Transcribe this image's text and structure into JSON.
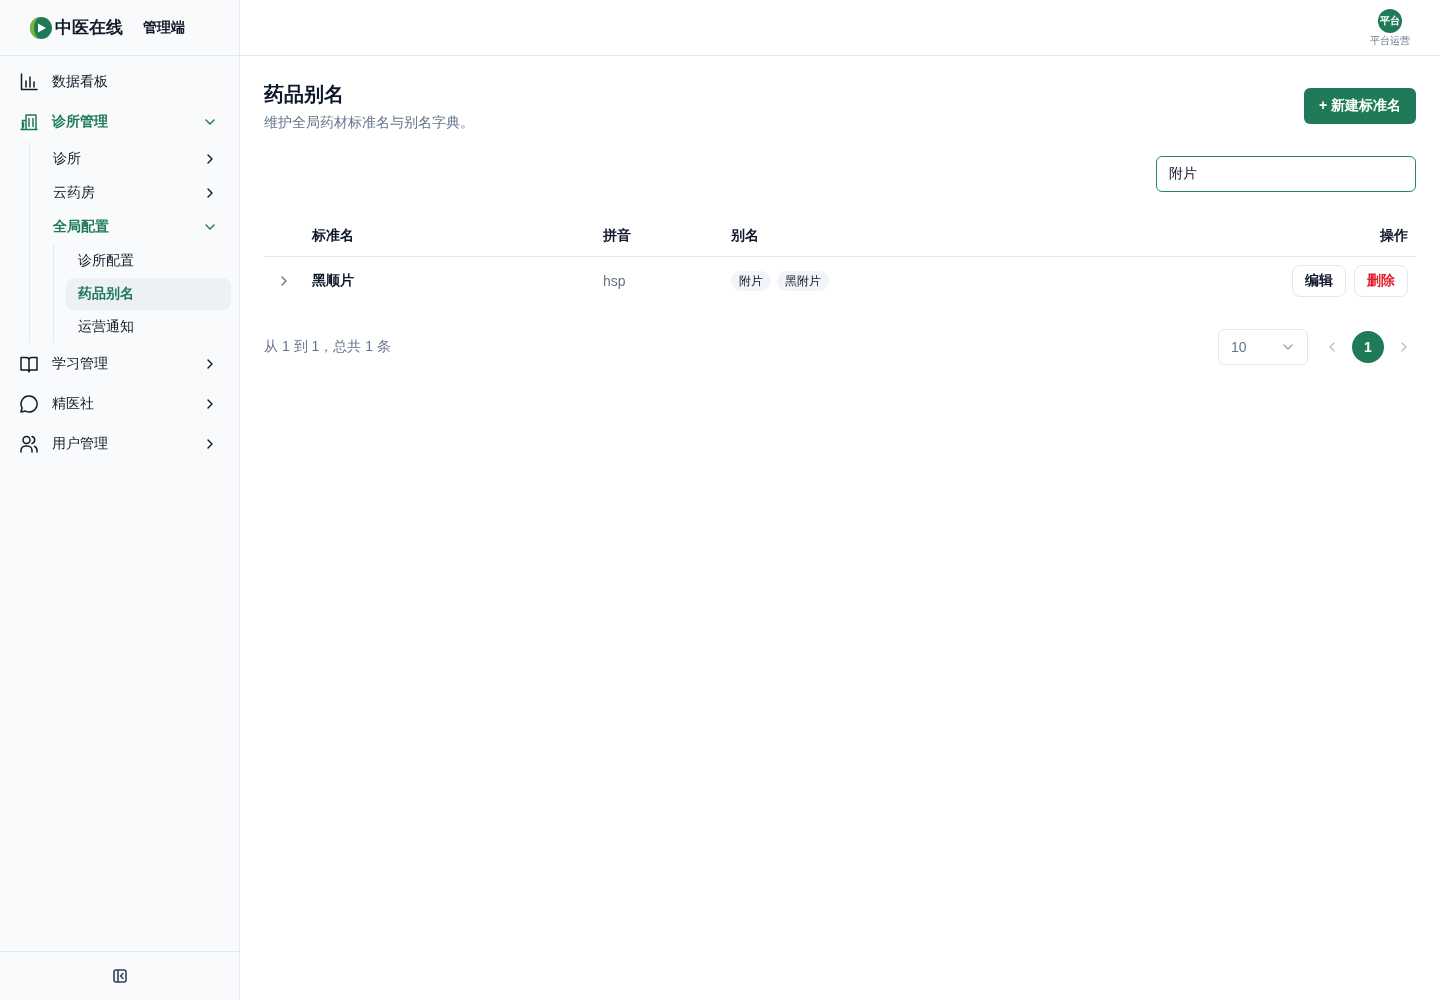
{
  "brand": {
    "name": "中医在线",
    "subtitle": "管理端"
  },
  "sidebar": {
    "items": [
      {
        "label": "数据看板",
        "selected": false
      },
      {
        "label": "诊所管理",
        "expanded": true,
        "children": [
          {
            "label": "诊所",
            "expanded": false
          },
          {
            "label": "云药房",
            "expanded": false
          },
          {
            "label": "全局配置",
            "expanded": true,
            "children": [
              {
                "label": "诊所配置",
                "selected": false
              },
              {
                "label": "药品别名",
                "selected": true
              },
              {
                "label": "运营通知",
                "selected": false
              }
            ]
          }
        ]
      },
      {
        "label": "学习管理",
        "expanded": false
      },
      {
        "label": "精医社",
        "expanded": false
      },
      {
        "label": "用户管理",
        "expanded": false
      }
    ]
  },
  "user": {
    "avatar_text": "平台",
    "role": "平台运营"
  },
  "page": {
    "title": "药品别名",
    "description": "维护全局药材标准名与别名字典。",
    "create_button": "+ 新建标准名"
  },
  "search": {
    "value": "附片",
    "focused": true
  },
  "table": {
    "columns": [
      "标准名",
      "拼音",
      "别名",
      "操作"
    ],
    "rows": [
      {
        "expanded": false,
        "name": "黑顺片",
        "pinyin": "hsp",
        "aliases": [
          "附片",
          "黑附片"
        ],
        "actions": [
          {
            "label": "编辑",
            "kind": "default"
          },
          {
            "label": "删除",
            "kind": "danger"
          }
        ]
      }
    ]
  },
  "pagination": {
    "summary": "从 1 到 1，总共 1 条",
    "page_size": "10",
    "prev_disabled": true,
    "next_disabled": true,
    "pages": [
      {
        "label": "1",
        "selected": true
      }
    ]
  }
}
